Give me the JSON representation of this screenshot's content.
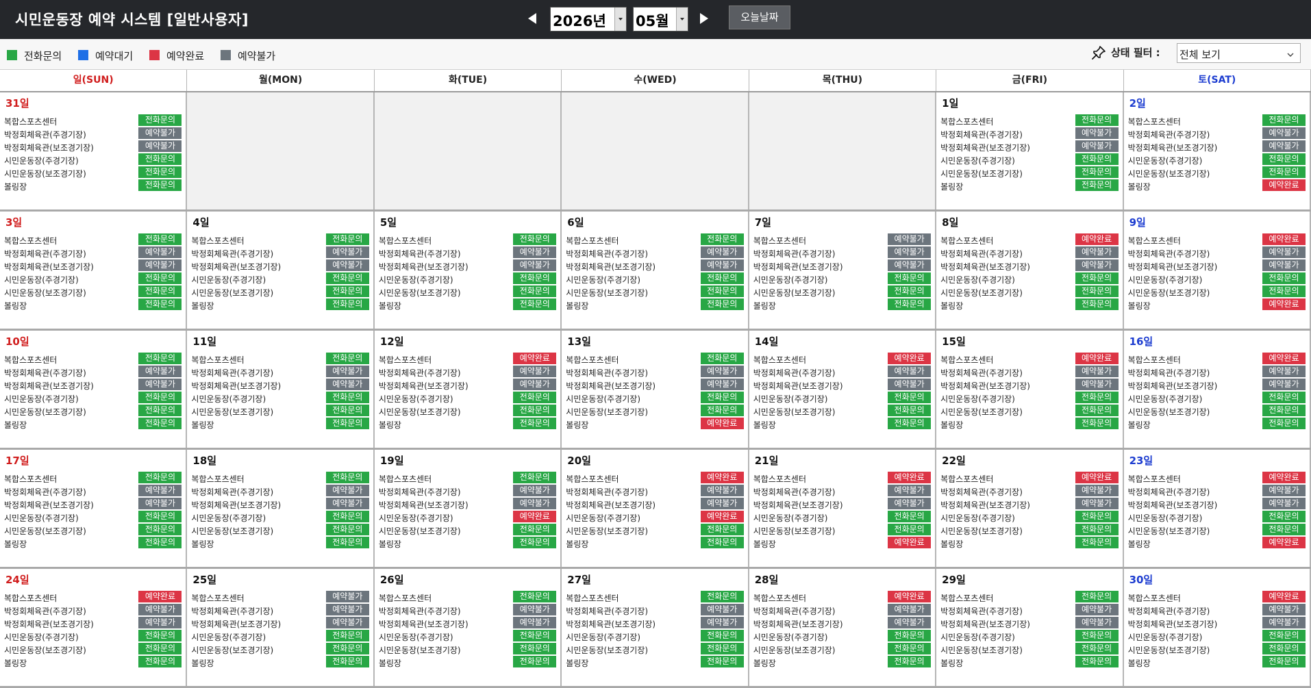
{
  "app": {
    "title": "시민운동장 예약 시스템 [일반사용자]"
  },
  "nav": {
    "year": "2026년",
    "month": "05월",
    "today_label": "오늘날짜"
  },
  "colors": {
    "phone": "#28a745",
    "wait": "#1e6fe6",
    "done": "#dc3545",
    "na": "#6c757d"
  },
  "legend": [
    {
      "key": "phone",
      "label": "전화문의"
    },
    {
      "key": "wait",
      "label": "예약대기"
    },
    {
      "key": "done",
      "label": "예약완료"
    },
    {
      "key": "na",
      "label": "예약불가"
    }
  ],
  "filter": {
    "label": "상태 필터 :",
    "value": "전체 보기"
  },
  "weekdays": [
    "일(SUN)",
    "월(MON)",
    "화(TUE)",
    "수(WED)",
    "목(THU)",
    "금(FRI)",
    "토(SAT)"
  ],
  "facilities": [
    "복합스포츠센터",
    "박정회체육관(주경기장)",
    "박정회체육관(보조경기장)",
    "시민운동장(주경기장)",
    "시민운동장(보조경기장)",
    "볼링장"
  ],
  "status_labels": {
    "P": "전화문의",
    "W": "예약대기",
    "D": "예약완료",
    "N": "예약불가"
  },
  "weeks": [
    [
      {
        "day": "31일",
        "st": [
          "P",
          "N",
          "N",
          "P",
          "P",
          "P"
        ]
      },
      null,
      null,
      null,
      null,
      {
        "day": "1일",
        "st": [
          "P",
          "N",
          "N",
          "P",
          "P",
          "P"
        ]
      },
      {
        "day": "2일",
        "st": [
          "P",
          "N",
          "N",
          "P",
          "P",
          "D"
        ]
      }
    ],
    [
      {
        "day": "3일",
        "st": [
          "P",
          "N",
          "N",
          "P",
          "P",
          "P"
        ]
      },
      {
        "day": "4일",
        "st": [
          "P",
          "N",
          "N",
          "P",
          "P",
          "P"
        ]
      },
      {
        "day": "5일",
        "st": [
          "P",
          "N",
          "N",
          "P",
          "P",
          "P"
        ]
      },
      {
        "day": "6일",
        "st": [
          "P",
          "N",
          "N",
          "P",
          "P",
          "P"
        ]
      },
      {
        "day": "7일",
        "st": [
          "N",
          "N",
          "N",
          "P",
          "P",
          "P"
        ]
      },
      {
        "day": "8일",
        "st": [
          "D",
          "N",
          "N",
          "P",
          "P",
          "P"
        ]
      },
      {
        "day": "9일",
        "st": [
          "D",
          "N",
          "N",
          "P",
          "P",
          "D"
        ]
      }
    ],
    [
      {
        "day": "10일",
        "st": [
          "P",
          "N",
          "N",
          "P",
          "P",
          "P"
        ]
      },
      {
        "day": "11일",
        "st": [
          "P",
          "N",
          "N",
          "P",
          "P",
          "P"
        ]
      },
      {
        "day": "12일",
        "st": [
          "D",
          "N",
          "N",
          "P",
          "P",
          "P"
        ]
      },
      {
        "day": "13일",
        "st": [
          "P",
          "N",
          "N",
          "P",
          "P",
          "D"
        ]
      },
      {
        "day": "14일",
        "st": [
          "D",
          "N",
          "N",
          "P",
          "P",
          "P"
        ]
      },
      {
        "day": "15일",
        "st": [
          "D",
          "N",
          "N",
          "P",
          "P",
          "P"
        ]
      },
      {
        "day": "16일",
        "st": [
          "D",
          "N",
          "N",
          "P",
          "P",
          "P"
        ]
      }
    ],
    [
      {
        "day": "17일",
        "st": [
          "P",
          "N",
          "N",
          "P",
          "P",
          "P"
        ]
      },
      {
        "day": "18일",
        "st": [
          "P",
          "N",
          "N",
          "P",
          "P",
          "P"
        ]
      },
      {
        "day": "19일",
        "st": [
          "P",
          "N",
          "N",
          "D",
          "P",
          "P"
        ]
      },
      {
        "day": "20일",
        "st": [
          "D",
          "N",
          "N",
          "D",
          "P",
          "P"
        ]
      },
      {
        "day": "21일",
        "st": [
          "D",
          "N",
          "N",
          "P",
          "P",
          "D"
        ]
      },
      {
        "day": "22일",
        "st": [
          "D",
          "N",
          "N",
          "P",
          "P",
          "P"
        ]
      },
      {
        "day": "23일",
        "st": [
          "D",
          "N",
          "N",
          "P",
          "P",
          "D"
        ]
      }
    ],
    [
      {
        "day": "24일",
        "st": [
          "D",
          "N",
          "N",
          "P",
          "P",
          "P"
        ]
      },
      {
        "day": "25일",
        "st": [
          "N",
          "N",
          "N",
          "P",
          "P",
          "P"
        ]
      },
      {
        "day": "26일",
        "st": [
          "P",
          "N",
          "N",
          "P",
          "P",
          "P"
        ]
      },
      {
        "day": "27일",
        "st": [
          "P",
          "N",
          "N",
          "P",
          "P",
          "P"
        ]
      },
      {
        "day": "28일",
        "st": [
          "D",
          "N",
          "N",
          "P",
          "P",
          "P"
        ]
      },
      {
        "day": "29일",
        "st": [
          "P",
          "N",
          "N",
          "P",
          "P",
          "P"
        ]
      },
      {
        "day": "30일",
        "st": [
          "D",
          "N",
          "N",
          "P",
          "P",
          "P"
        ]
      }
    ]
  ]
}
